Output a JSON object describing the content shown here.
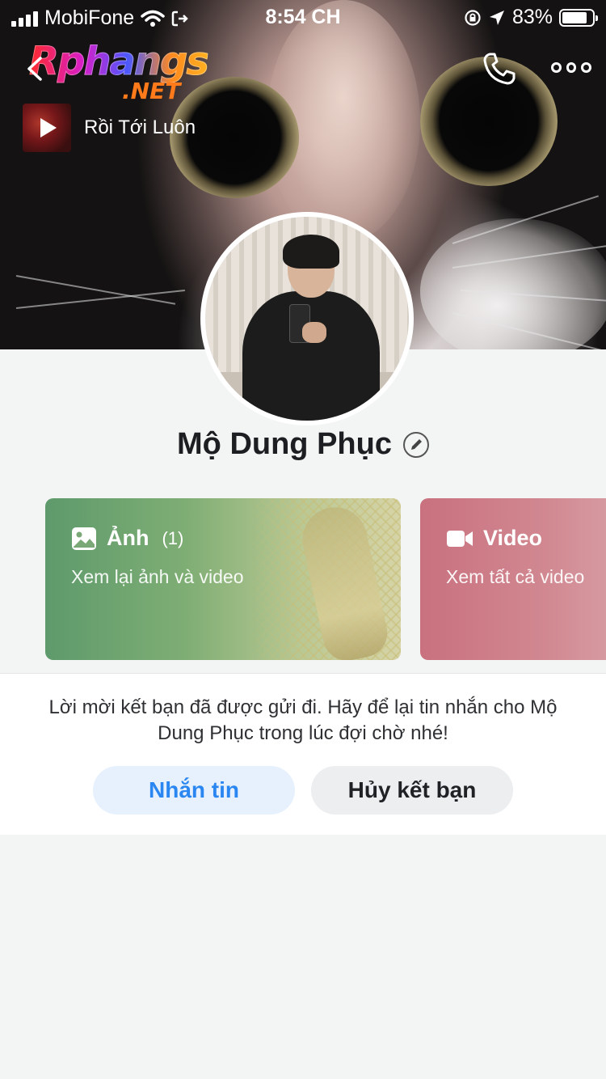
{
  "status_bar": {
    "carrier": "MobiFone",
    "time": "8:54 CH",
    "battery": "83%",
    "battery_level": 0.83
  },
  "watermark": {
    "main": "Rphangs",
    "sub": ".NET"
  },
  "header": {
    "back_icon": "chevron-left-icon",
    "call_icon": "phone-icon",
    "more_icon": "more-dots-icon"
  },
  "profile_song": {
    "title": "Rồi Tới Luôn",
    "icon": "play-icon"
  },
  "profile": {
    "name": "Mộ Dung Phục",
    "edit_icon": "pencil-icon"
  },
  "media_cards": [
    {
      "title": "Ảnh",
      "count": "(1)",
      "subtitle": "Xem lại ảnh và video",
      "icon": "image-icon",
      "color": "#6fa472"
    },
    {
      "title": "Video",
      "count": "",
      "subtitle": "Xem tất cả video",
      "icon": "video-camera-icon",
      "color": "#cd7a85"
    }
  ],
  "friend_request": {
    "message": "Lời mời kết bạn đã được gửi đi. Hãy để lại tin nhắn cho Mộ Dung Phục trong lúc đợi chờ nhé!",
    "message_button": "Nhắn tin",
    "unfriend_button": "Hủy kết bạn"
  },
  "colors": {
    "accent": "#2a86f0",
    "message_button_bg": "#e7f1fd",
    "secondary_button_bg": "#eceef0",
    "page_bg": "#f3f4f4"
  }
}
